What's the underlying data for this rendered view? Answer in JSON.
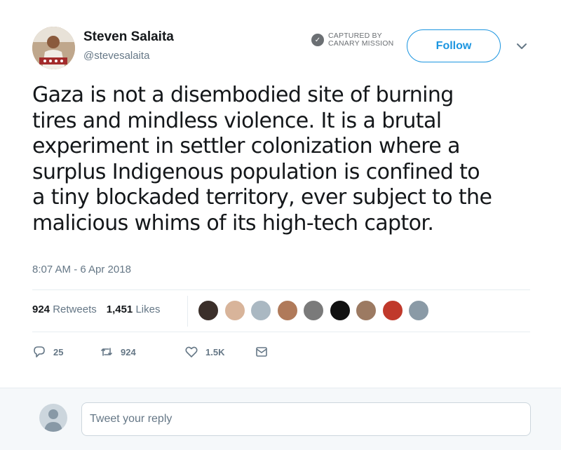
{
  "user": {
    "name": "Steven Salaita",
    "handle": "@stevesalaita"
  },
  "watermark": {
    "line1": "CAPTURED BY",
    "line2": "CANARY MISSION"
  },
  "follow_label": "Follow",
  "tweet": {
    "text": "Gaza is not a disembodied site of burning\ntires and mindless violence.  It is a brutal\nexperiment in settler colonization where a\nsurplus Indigenous population is confined to\na tiny blockaded territory, ever subject to the\nmalicious whims of its high-tech captor.",
    "timestamp": "8:07 AM - 6 Apr 2018"
  },
  "stats": {
    "retweets_count": "924",
    "retweets_label": "Retweets",
    "likes_count": "1,451",
    "likes_label": "Likes"
  },
  "likers": [
    {
      "color": "#3b2f2a"
    },
    {
      "color": "#d8b49a"
    },
    {
      "color": "#aab8c2"
    },
    {
      "color": "#b07a5a"
    },
    {
      "color": "#7a7a7a"
    },
    {
      "color": "#111111"
    },
    {
      "color": "#9c7a62"
    },
    {
      "color": "#c0392b"
    },
    {
      "color": "#8a9aa6"
    }
  ],
  "actions": {
    "replies": "25",
    "retweets": "924",
    "likes": "1.5K"
  },
  "reply": {
    "placeholder": "Tweet your reply"
  },
  "colors": {
    "accent": "#1b95e0",
    "muted": "#657786",
    "text": "#14171a"
  }
}
